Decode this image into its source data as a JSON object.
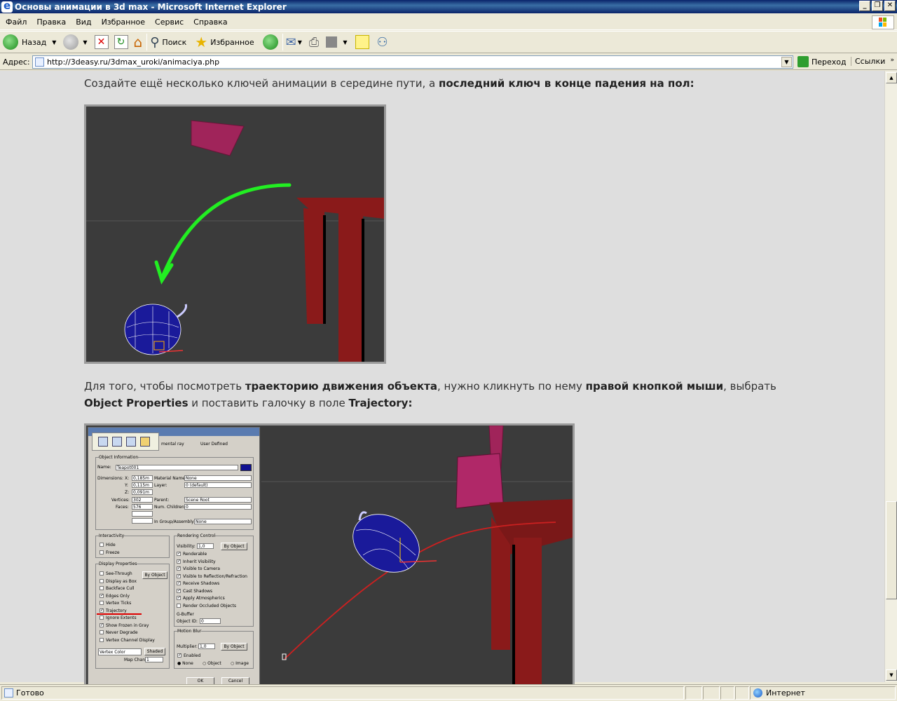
{
  "window": {
    "title": "Основы анимации в 3d max - Microsoft Internet Explorer"
  },
  "menu": [
    "Файл",
    "Правка",
    "Вид",
    "Избранное",
    "Сервис",
    "Справка"
  ],
  "toolbar": {
    "back": "Назад",
    "search": "Поиск",
    "favorites": "Избранное"
  },
  "address": {
    "label": "Адрес:",
    "url": "http://3deasy.ru/3dmax_uroki/animaciya.php",
    "go": "Переход",
    "links": "Ссылки"
  },
  "article": {
    "p1_a": "Создайте ещё несколько ключей анимации в середине пути, а ",
    "p1_b": "последний ключ в конце падения на пол:",
    "p2_a": "Для того, чтобы посмотреть ",
    "p2_b": "траекторию движения объекта",
    "p2_c": ", нужно кликнуть по нему ",
    "p2_d": "правой кнопкой мыши",
    "p2_e": ", выбрать ",
    "p2_f": "Object Properties",
    "p2_g": " и поставить галочку в поле ",
    "p2_h": "Trajectory:"
  },
  "dialog": {
    "tabs": [
      "mental ray",
      "User Defined"
    ],
    "group_info": "Object Information",
    "name_label": "Name:",
    "name_value": "Teapot001",
    "dimensions": "Dimensions:",
    "x": "X:",
    "x_val": "0,185m",
    "y": "Y:",
    "y_val": "0,115m",
    "z": "Z:",
    "z_val": "0,091m",
    "vertices": "Vertices:",
    "vertices_val": "302",
    "faces": "Faces:",
    "faces_val": "576",
    "material_name": "Material Name:",
    "material_val": "None",
    "layer": "Layer:",
    "layer_val": "0 (default)",
    "parent": "Parent:",
    "parent_val": "Scene Root",
    "num_children": "Num. Children:",
    "num_children_val": "0",
    "group_assembly": "In Group/Assembly:",
    "group_assembly_val": "None",
    "interactivity": "Interactivity",
    "hide": "Hide",
    "freeze": "Freeze",
    "display_props": "Display Properties",
    "display_items": [
      "See-Through",
      "Display as Box",
      "Backface Cull",
      "Edges Only",
      "Vertex Ticks",
      "Trajectory",
      "Ignore Extents",
      "Show Frozen in Gray",
      "Never Degrade",
      "Vertex Channel Display"
    ],
    "display_checked": [
      false,
      false,
      false,
      true,
      false,
      true,
      false,
      true,
      false,
      false
    ],
    "by_object": "By Object",
    "vertex_color": "Vertex Color",
    "shaded": "Shaded",
    "map_channel": "Map Channel:",
    "map_channel_val": "1",
    "rendering_control": "Rendering Control",
    "visibility": "Visibility:",
    "visibility_val": "1,0",
    "render_items": [
      "Renderable",
      "Inherit Visibility",
      "Visible to Camera",
      "Visible to Reflection/Refraction",
      "Receive Shadows",
      "Cast Shadows",
      "Apply Atmospherics",
      "Render Occluded Objects"
    ],
    "render_checked": [
      true,
      true,
      true,
      true,
      true,
      true,
      true,
      false
    ],
    "gbuffer": "G-Buffer",
    "object_id": "Object ID:",
    "object_id_val": "0",
    "motion_blur": "Motion Blur",
    "multiplier": "Multiplier:",
    "multiplier_val": "1,0",
    "enabled": "Enabled",
    "radio": [
      "None",
      "Object",
      "Image"
    ],
    "ok": "OK",
    "cancel": "Cancel"
  },
  "status": {
    "left": "Готово",
    "zone": "Интернет"
  }
}
